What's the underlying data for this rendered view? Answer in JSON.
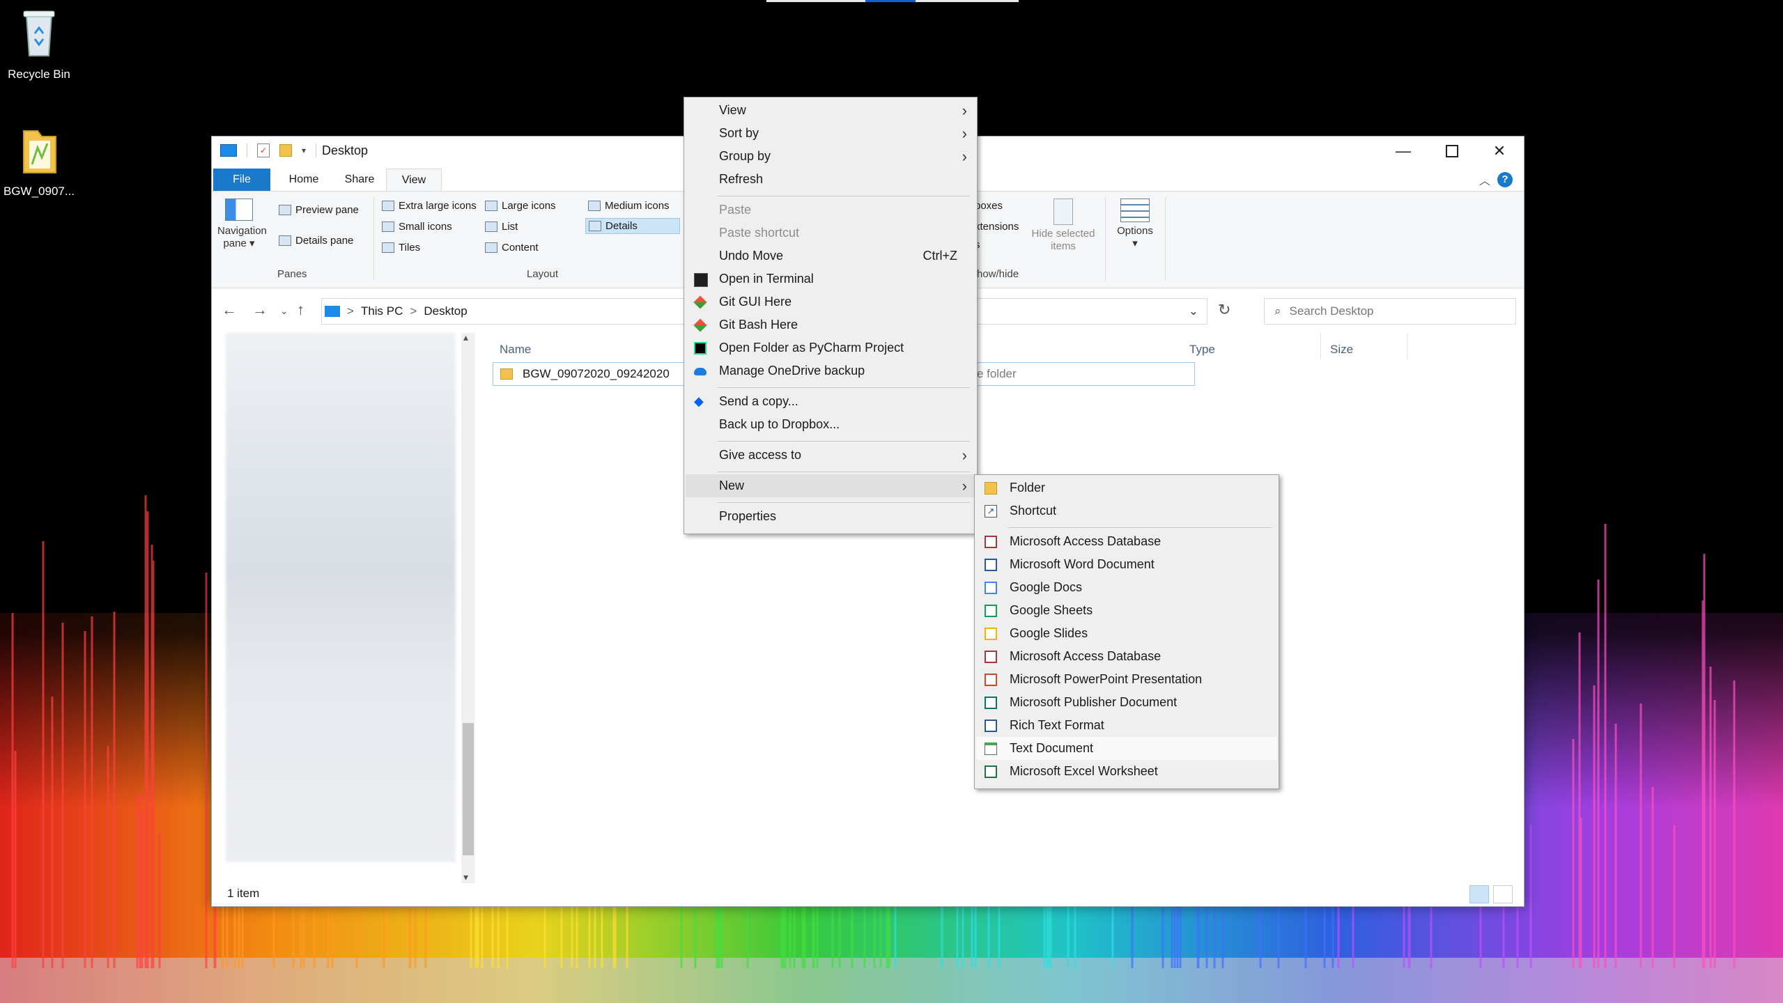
{
  "desktop": {
    "icons": [
      {
        "label": "Recycle Bin",
        "icon": "recycle-bin-icon"
      },
      {
        "label": "BGW_0907...",
        "icon": "folder-icon"
      }
    ]
  },
  "window": {
    "title": "Desktop",
    "tabs": [
      "File",
      "Home",
      "Share",
      "View"
    ],
    "active_tab": "View",
    "ribbon": {
      "panes": {
        "label": "Panes",
        "navigation_pane": "Navigation pane",
        "preview_pane": "Preview pane",
        "details_pane": "Details pane"
      },
      "layout": {
        "label": "Layout",
        "items": [
          "Extra large icons",
          "Large icons",
          "Medium icons",
          "Small icons",
          "List",
          "Details",
          "Tiles",
          "Content"
        ],
        "selected": "Details"
      },
      "show_hide": {
        "label_partial": "how/hide",
        "boxes_partial": "boxes",
        "extensions_partial": "xtensions",
        "s_partial": "s",
        "hide_selected_items": "Hide selected items",
        "options": "Options"
      }
    },
    "address": {
      "path": [
        "This PC",
        "Desktop"
      ],
      "search_placeholder": "Search Desktop"
    },
    "columns": {
      "name": "Name",
      "type": "Type",
      "size": "Size"
    },
    "rows": [
      {
        "name": "BGW_09072020_09242020",
        "type": "File folder",
        "size": ""
      }
    ],
    "status": "1 item"
  },
  "context_menu": {
    "items": [
      {
        "label": "View",
        "submenu": true
      },
      {
        "label": "Sort by",
        "submenu": true
      },
      {
        "label": "Group by",
        "submenu": true
      },
      {
        "label": "Refresh"
      },
      {
        "label": "Paste",
        "disabled": true
      },
      {
        "label": "Paste shortcut",
        "disabled": true
      },
      {
        "label": "Undo Move",
        "shortcut": "Ctrl+Z"
      },
      {
        "label": "Open in Terminal",
        "icon": "terminal-icon"
      },
      {
        "label": "Git GUI Here",
        "icon": "git-icon"
      },
      {
        "label": "Git Bash Here",
        "icon": "git-icon"
      },
      {
        "label": "Open Folder as PyCharm Project",
        "icon": "pycharm-icon"
      },
      {
        "label": "Manage OneDrive backup",
        "icon": "onedrive-icon"
      },
      {
        "label": "Send a copy...",
        "icon": "dropbox-icon"
      },
      {
        "label": "Back up to Dropbox..."
      },
      {
        "label": "Give access to",
        "submenu": true
      },
      {
        "label": "New",
        "submenu": true,
        "highlighted": true
      },
      {
        "label": "Properties"
      }
    ]
  },
  "new_submenu": {
    "items": [
      {
        "label": "Folder",
        "icon": "folder-icon"
      },
      {
        "label": "Shortcut",
        "icon": "shortcut-icon"
      },
      {
        "label": "Microsoft Access Database",
        "icon": "access-icon"
      },
      {
        "label": "Microsoft Word Document",
        "icon": "word-icon"
      },
      {
        "label": "Google Docs",
        "icon": "google-docs-icon"
      },
      {
        "label": "Google Sheets",
        "icon": "google-sheets-icon"
      },
      {
        "label": "Google Slides",
        "icon": "google-slides-icon"
      },
      {
        "label": "Microsoft Access Database",
        "icon": "access-icon"
      },
      {
        "label": "Microsoft PowerPoint Presentation",
        "icon": "powerpoint-icon"
      },
      {
        "label": "Microsoft Publisher Document",
        "icon": "publisher-icon"
      },
      {
        "label": "Rich Text Format",
        "icon": "rtf-icon"
      },
      {
        "label": "Text Document",
        "icon": "text-document-icon",
        "hovered": true
      },
      {
        "label": "Microsoft Excel Worksheet",
        "icon": "excel-icon"
      }
    ]
  },
  "colors": {
    "accent": "#1979ca",
    "selection": "#cce4f7"
  }
}
